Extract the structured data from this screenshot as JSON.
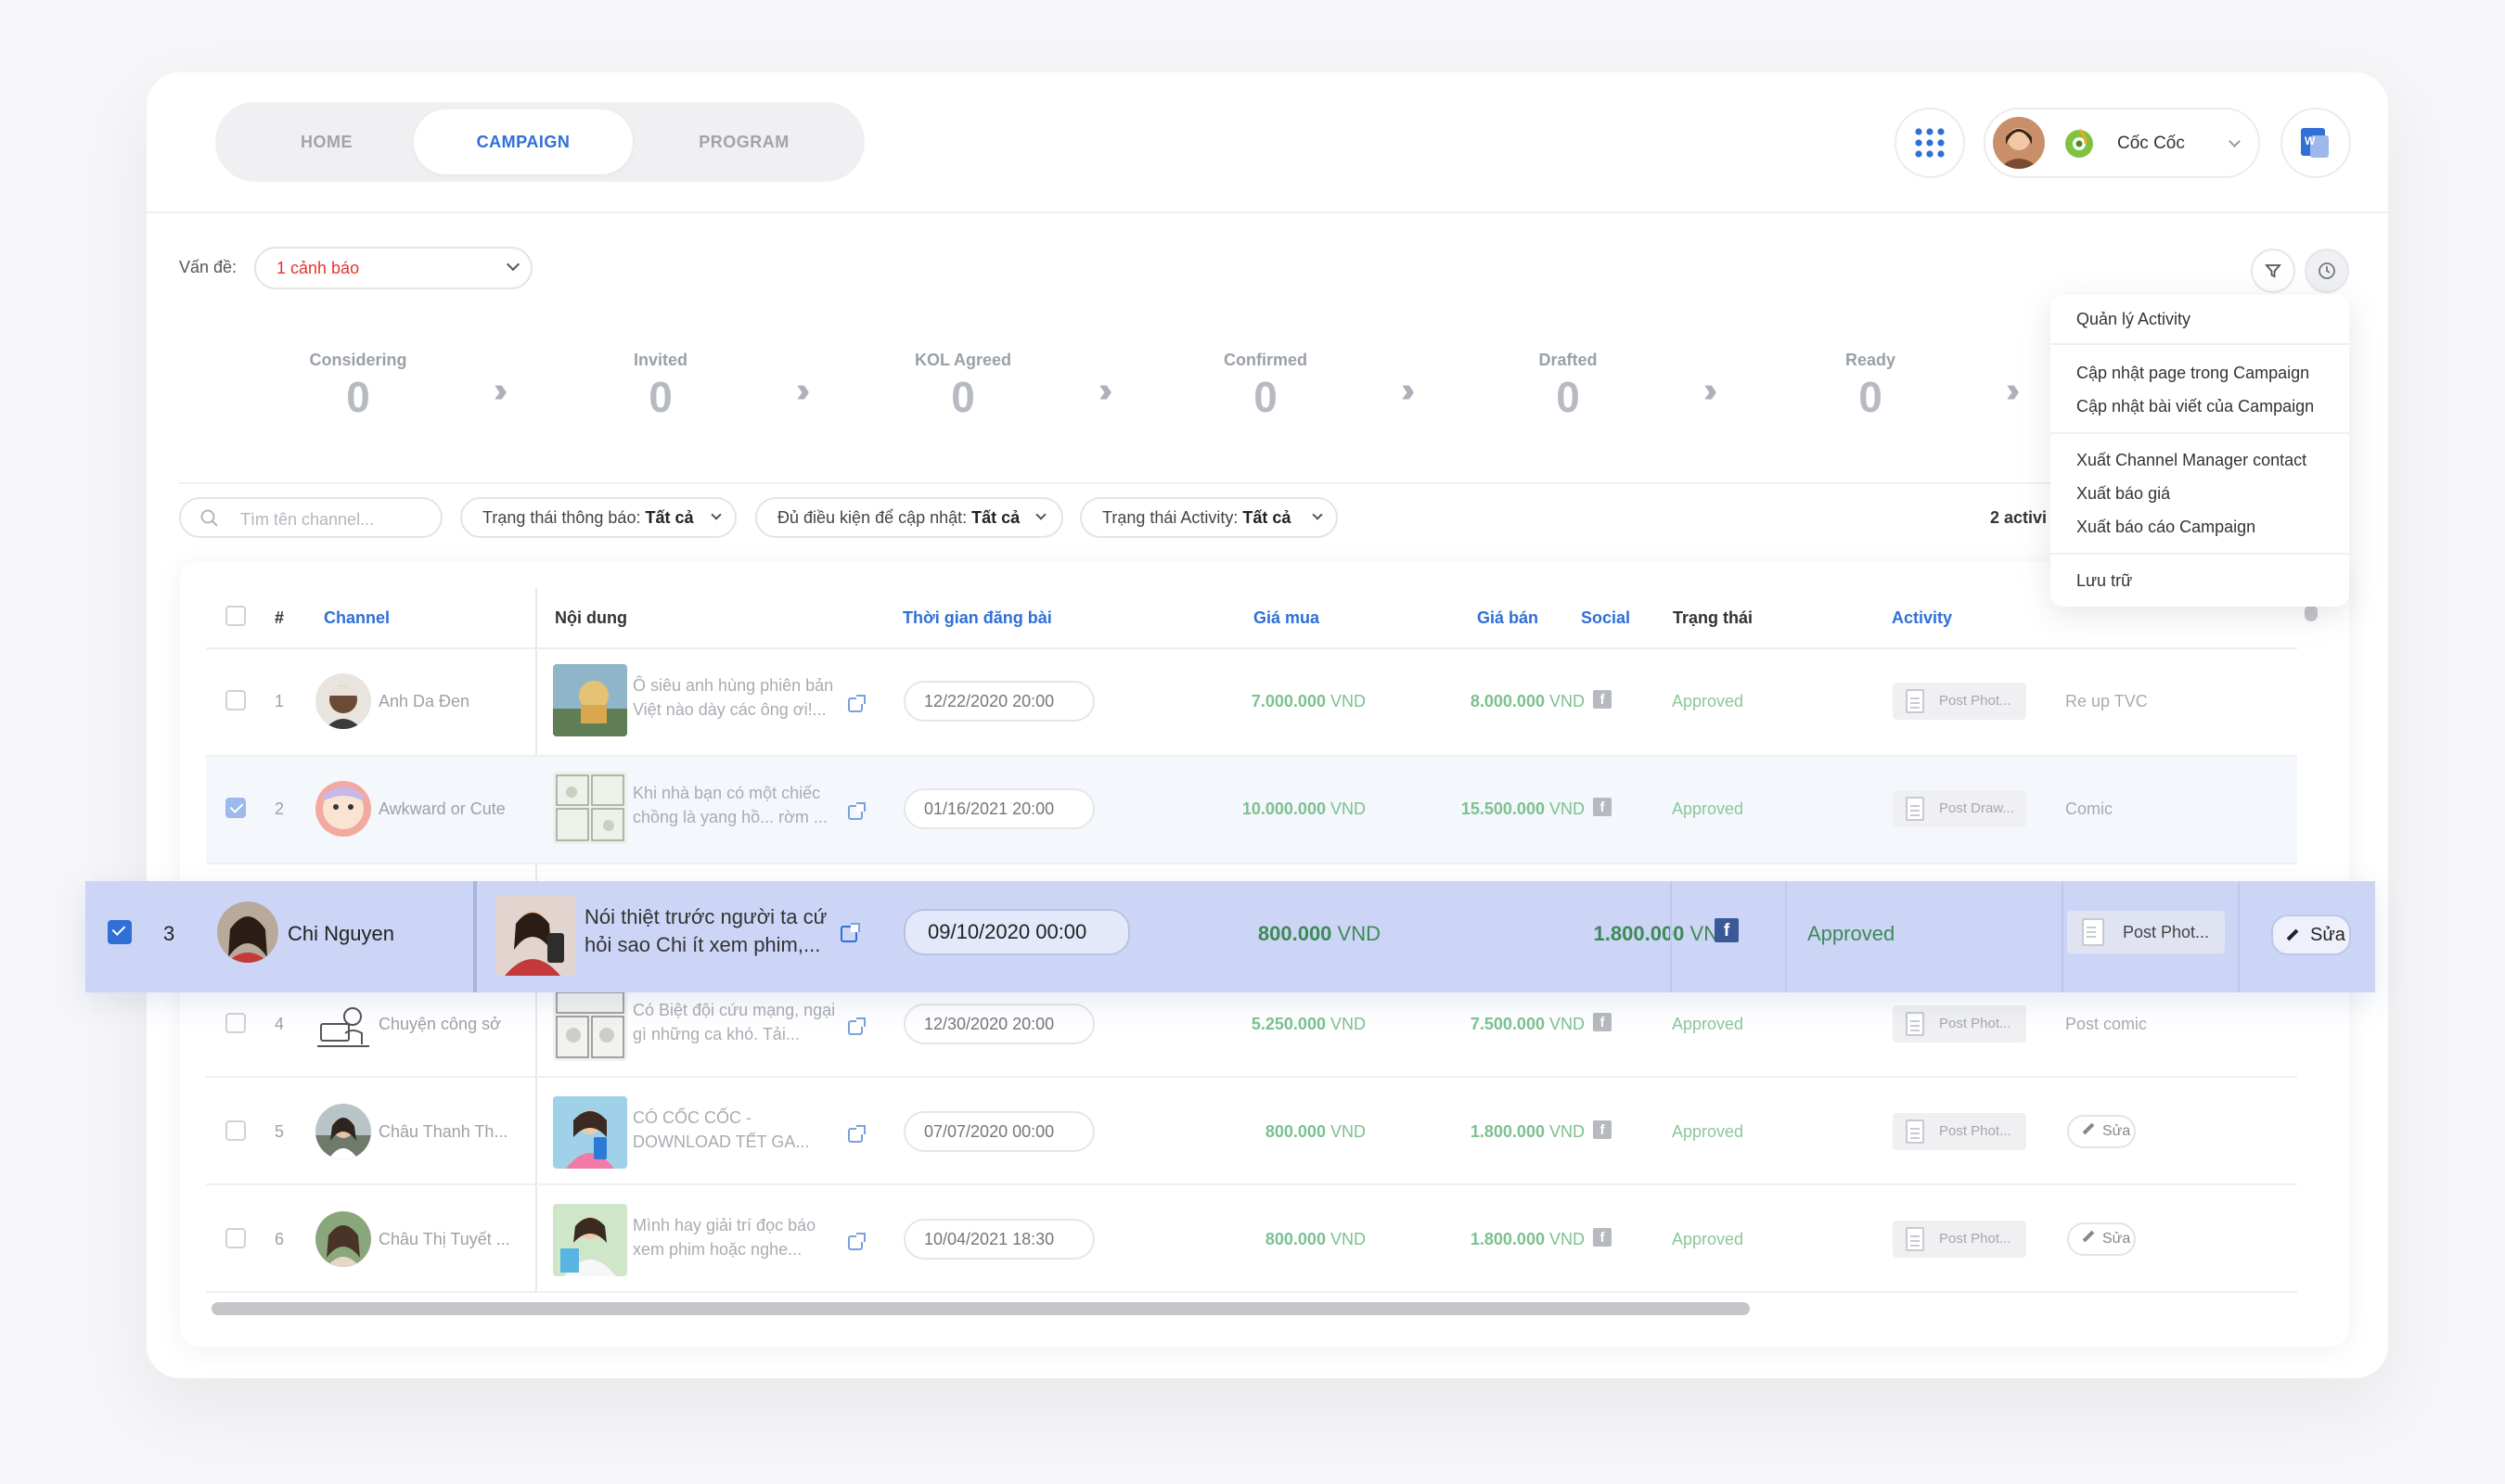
{
  "nav": {
    "tabs": [
      {
        "label": "HOME"
      },
      {
        "label": "CAMPAIGN"
      },
      {
        "label": "PROGRAM"
      }
    ]
  },
  "account": {
    "name": "Cốc Cốc"
  },
  "issue": {
    "label": "Vấn đề:",
    "value": "1 cảnh báo"
  },
  "pipeline": [
    {
      "label": "Considering",
      "count": "0"
    },
    {
      "label": "Invited",
      "count": "0"
    },
    {
      "label": "KOL Agreed",
      "count": "0"
    },
    {
      "label": "Confirmed",
      "count": "0"
    },
    {
      "label": "Drafted",
      "count": "0"
    },
    {
      "label": "Ready",
      "count": "0"
    }
  ],
  "filters": {
    "search_placeholder": "Tìm tên channel...",
    "notify": {
      "label": "Trạng thái thông báo:",
      "value": "Tất cả"
    },
    "eligible": {
      "label": "Đủ điều kiện để cập nhật:",
      "value": "Tất cả"
    },
    "activity": {
      "label": "Trạng thái Activity:",
      "value": "Tất cả"
    },
    "count_text": "2 activi"
  },
  "table": {
    "headers": {
      "index": "#",
      "channel": "Channel",
      "content": "Nội dung",
      "post_time": "Thời gian đăng bài",
      "buy": "Giá mua",
      "sell": "Giá bán",
      "social": "Social",
      "status": "Trạng thái",
      "activity": "Activity"
    },
    "rows": [
      {
        "index": "1",
        "channel": "Anh Da Đen",
        "content": "Ô siêu anh hùng phiên bản Việt nào dày các ông ơi!...",
        "time": "12/22/2020 20:00",
        "buy": "7.000.000",
        "sell": "8.000.000",
        "currency": "VND",
        "social": "f",
        "status": "Approved",
        "activity": "Post Phot...",
        "note": "Re up TVC"
      },
      {
        "index": "2",
        "channel": "Awkward or Cute",
        "content": "Khi nhà bạn có một chiếc chồng là yang hồ... rờm ...",
        "time": "01/16/2021 20:00",
        "buy": "10.000.000",
        "sell": "15.500.000",
        "currency": "VND",
        "social": "f",
        "status": "Approved",
        "activity": "Post Draw...",
        "note": "Comic"
      },
      {
        "index": "4",
        "channel": "Chuyện công sở",
        "content": "Có Biệt đội cứu mạng, ngại gì những ca khó. Tải...",
        "time": "12/30/2020 20:00",
        "buy": "5.250.000",
        "sell": "7.500.000",
        "currency": "VND",
        "social": "f",
        "status": "Approved",
        "activity": "Post Phot...",
        "note": "Post comic"
      },
      {
        "index": "5",
        "channel": "Châu Thanh Th...",
        "content": "CÓ CỐC CỐC - DOWNLOAD TẾT GA...",
        "time": "07/07/2020 00:00",
        "buy": "800.000",
        "sell": "1.800.000",
        "currency": "VND",
        "social": "f",
        "status": "Approved",
        "activity": "Post Phot...",
        "edit": "Sửa"
      },
      {
        "index": "6",
        "channel": "Châu Thị Tuyết ...",
        "content": "Mình hay giải trí đọc báo xem phim hoặc nghe...",
        "time": "10/04/2021 18:30",
        "buy": "800.000",
        "sell": "1.800.000",
        "currency": "VND",
        "social": "f",
        "status": "Approved",
        "activity": "Post Phot...",
        "edit": "Sửa"
      }
    ],
    "dragged": {
      "index": "3",
      "channel": "Chi Nguyen",
      "content": "Nói thiệt trước người ta cứ hỏi sao Chi ít xem phim,...",
      "time": "09/10/2020 00:00",
      "buy": "800.000",
      "sell": "1.800.000",
      "currency": "VND",
      "social": "f",
      "status": "Approved",
      "activity": "Post Phot...",
      "edit": "Sửa"
    }
  },
  "menu": {
    "items": [
      "Quản lý Activity",
      "Cập nhật page trong Campaign",
      "Cập nhật bài viết của Campaign",
      "Xuất Channel Manager contact",
      "Xuất báo giá",
      "Xuất báo cáo Campaign",
      "Lưu trữ"
    ]
  },
  "colors": {
    "accent": "#2f6fd6",
    "alert": "#e5342b",
    "approved": "#7bc18e",
    "drag_row": "#ccd5f6"
  }
}
